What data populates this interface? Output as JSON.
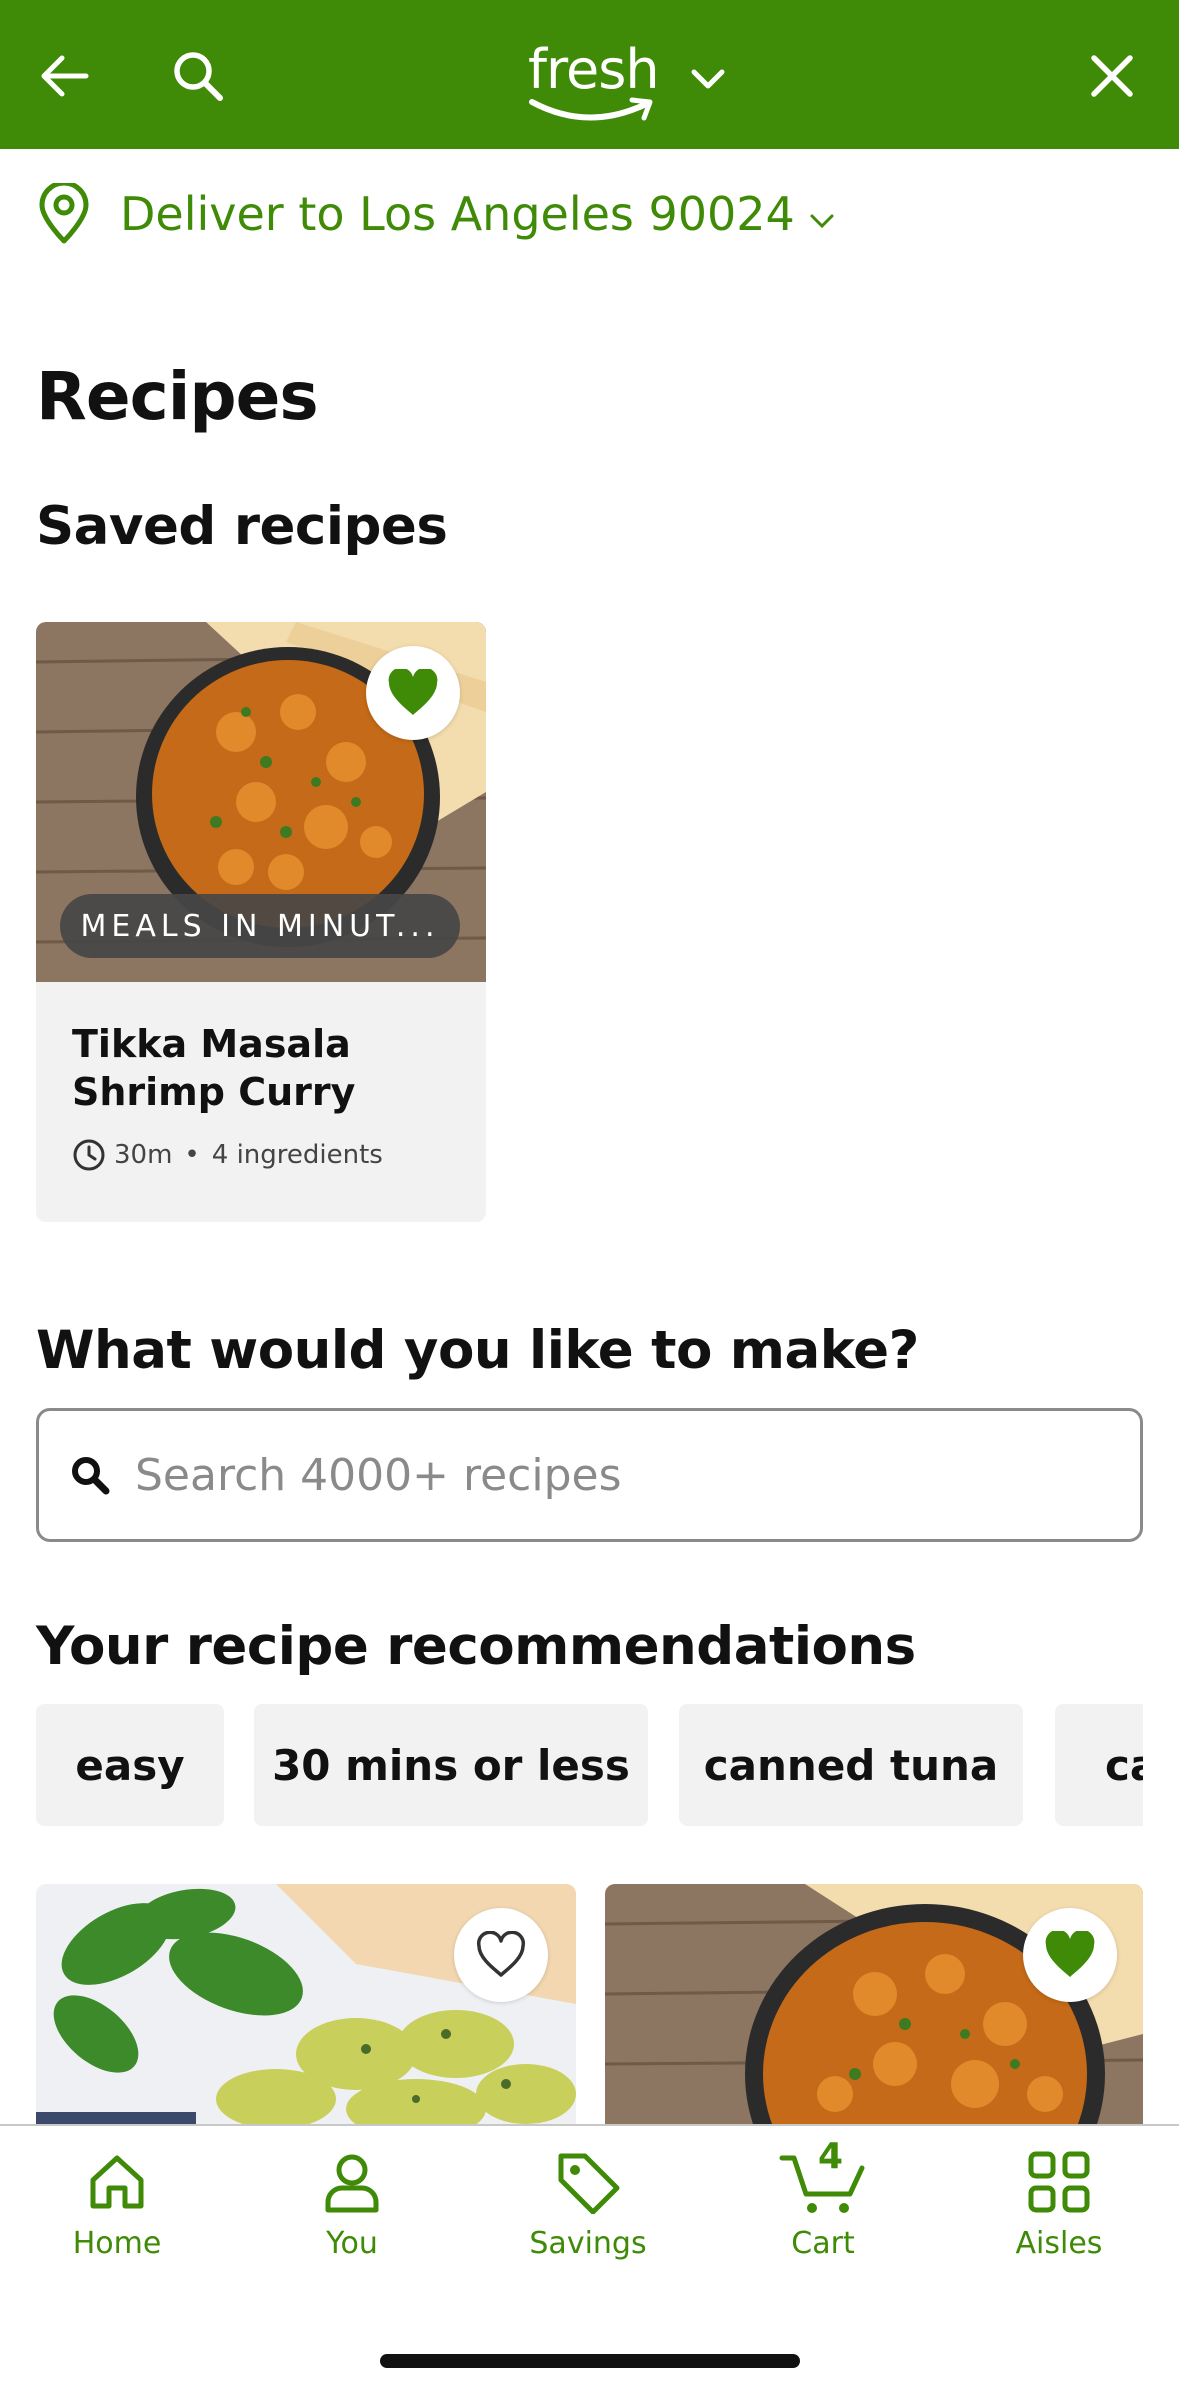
{
  "colors": {
    "brand_green": "#3f8a06",
    "header_bg": "#3f8a06",
    "card_bg": "#f2f2f2",
    "heart_green": "#3f8a06"
  },
  "header": {
    "logo_text": "fresh",
    "icons": {
      "back": "arrow-left-icon",
      "search": "search-icon",
      "dropdown": "chevron-down-icon",
      "close": "close-icon"
    }
  },
  "location": {
    "text": "Deliver to Los Angeles 90024",
    "icon": "location-pin-icon"
  },
  "page": {
    "title": "Recipes"
  },
  "saved": {
    "heading": "Saved recipes",
    "card": {
      "badge": "MEALS IN MINUT...",
      "title": "Tikka Masala Shrimp Curry",
      "time": "30m",
      "separator": "•",
      "ingredients": "4 ingredients",
      "saved": true
    }
  },
  "make": {
    "heading": "What would you like to make?",
    "search_placeholder": "Search 4000+ recipes"
  },
  "recommendations": {
    "heading": "Your recipe recommendations",
    "chips": [
      "easy",
      "30 mins or less",
      "canned tuna",
      "ca"
    ],
    "cards": [
      {
        "image": "tortellini-basil-photo",
        "saved": false
      },
      {
        "image": "shrimp-curry-photo",
        "saved": true
      }
    ]
  },
  "bottom_nav": {
    "items": [
      {
        "label": "Home",
        "icon": "home-icon"
      },
      {
        "label": "You",
        "icon": "person-icon"
      },
      {
        "label": "Savings",
        "icon": "tag-icon"
      },
      {
        "label": "Cart",
        "icon": "cart-icon",
        "badge": "4"
      },
      {
        "label": "Aisles",
        "icon": "grid-icon"
      }
    ]
  }
}
